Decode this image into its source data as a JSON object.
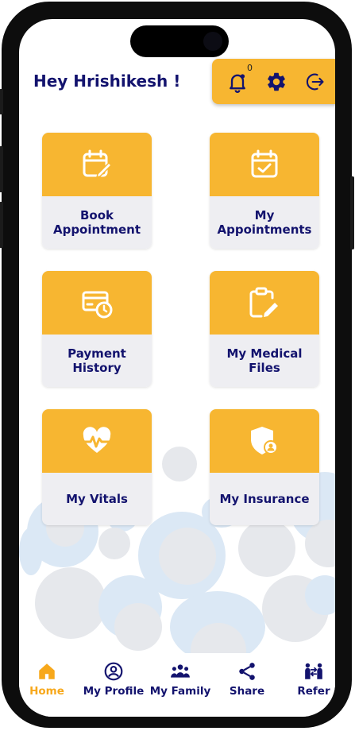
{
  "header": {
    "greeting": "Hey Hrishikesh !"
  },
  "top_actions": {
    "notification_count": "0",
    "icons": [
      "bell-icon",
      "gear-icon",
      "logout-icon"
    ]
  },
  "tiles": [
    {
      "label": "Book Appointment",
      "icon": "calendar-edit-icon"
    },
    {
      "label": "My Appointments",
      "icon": "calendar-check-icon"
    },
    {
      "label": "Payment History",
      "icon": "payment-card-clock-icon"
    },
    {
      "label": "My Medical Files",
      "icon": "clipboard-edit-icon"
    },
    {
      "label": "My Vitals",
      "icon": "heart-pulse-icon"
    },
    {
      "label": "My Insurance",
      "icon": "shield-user-icon"
    }
  ],
  "bottom_nav": [
    {
      "label": "Home",
      "icon": "home-icon",
      "active": true
    },
    {
      "label": "My Profile",
      "icon": "profile-icon"
    },
    {
      "label": "My Family",
      "icon": "family-icon"
    },
    {
      "label": "Share",
      "icon": "share-icon"
    },
    {
      "label": "Refer",
      "icon": "refer-icon"
    }
  ],
  "colors": {
    "accent": "#f7b631",
    "text_primary": "#13136e",
    "tile_bottom": "#eeeef2",
    "nav_active": "#f7a81b"
  }
}
